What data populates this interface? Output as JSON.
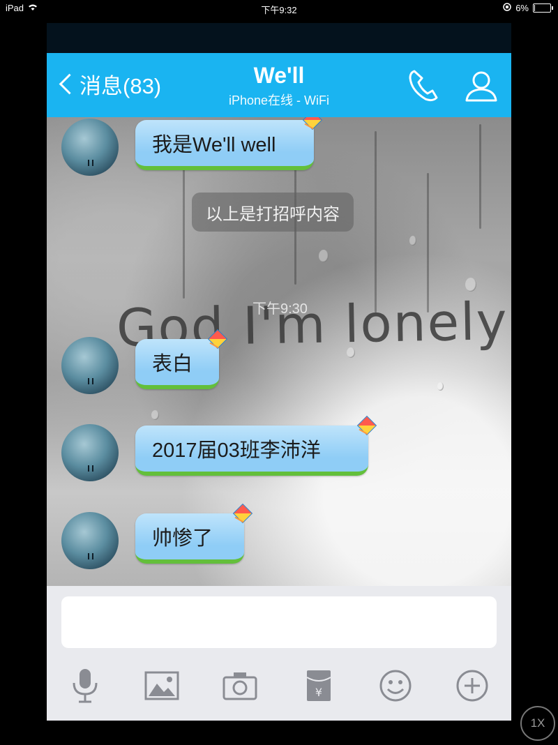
{
  "ipad_status": {
    "device": "iPad",
    "time": "下午9:32",
    "battery": "6%",
    "battery_fraction": 0.06
  },
  "header": {
    "back_label": "消息(83)",
    "title": "We'll",
    "subtitle": "iPhone在线 - WiFi"
  },
  "chat": {
    "background_text": "God I'm lonely",
    "system_message": "以上是打招呼内容",
    "timestamp": "下午9:30",
    "messages": [
      {
        "text": "我是We'll well"
      },
      {
        "text": "表白"
      },
      {
        "text": "2017届03班李沛洋"
      },
      {
        "text": "帅惨了"
      }
    ]
  },
  "toolbar": {
    "icons": [
      "microphone-icon",
      "image-icon",
      "camera-icon",
      "red-packet-icon",
      "emoji-icon",
      "plus-icon"
    ],
    "red_packet_symbol": "¥"
  },
  "zoom_label": "1X",
  "colors": {
    "header": "#1ab4f1",
    "bubble": "#8fcdf6",
    "bubble_grass": "#63bf3b",
    "toolbar_icon": "#8a8c93"
  }
}
